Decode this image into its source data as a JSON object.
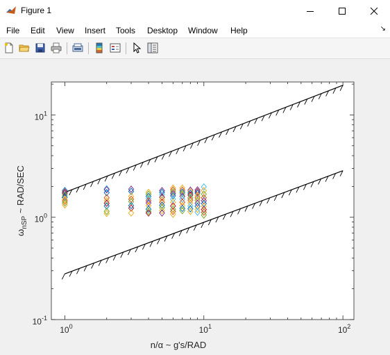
{
  "window": {
    "title": "Figure 1",
    "minimize_icon": "minimize-icon",
    "maximize_icon": "maximize-icon",
    "close_icon": "close-icon"
  },
  "menu": {
    "items": [
      "File",
      "Edit",
      "View",
      "Insert",
      "Tools",
      "Desktop",
      "Window",
      "Help"
    ],
    "dock_icon": "dock-arrow-icon"
  },
  "toolbar": {
    "buttons": [
      "new-figure-icon",
      "open-file-icon",
      "save-icon",
      "print-icon",
      "print-preview-icon",
      "colorbar-icon",
      "legend-icon",
      "pointer-icon",
      "property-inspector-icon"
    ]
  },
  "colors": {
    "series": [
      "#0072BD",
      "#D95319",
      "#EDB120",
      "#7E2F8E",
      "#77AC30",
      "#4DBEEE",
      "#A2142F"
    ],
    "boundary": "#000000",
    "axes_background": "#ffffff",
    "figure_background": "#f0f0f0"
  },
  "chart_data": {
    "type": "scatter",
    "title": "",
    "xlabel": "n/α ~ g's/RAD",
    "ylabel": "ω_nSP ~ RAD/SEC",
    "xscale": "log",
    "yscale": "log",
    "xlim": [
      0.8,
      120
    ],
    "ylim": [
      0.1,
      21
    ],
    "grid": false,
    "legend": "none",
    "x_ticks": [
      {
        "value": 1,
        "base": "10",
        "exp": "0"
      },
      {
        "value": 10,
        "base": "10",
        "exp": "1"
      },
      {
        "value": 100,
        "base": "10",
        "exp": "2"
      }
    ],
    "y_ticks": [
      {
        "value": 0.1,
        "base": "10",
        "exp": "-1"
      },
      {
        "value": 1,
        "base": "10",
        "exp": "0"
      },
      {
        "value": 10,
        "base": "10",
        "exp": "1"
      }
    ],
    "ylabel_parts": {
      "omega": "ω",
      "sub": "nSP",
      "rest": " ~ RAD/SEC"
    },
    "boundaries": [
      {
        "name": "upper",
        "x": [
          1,
          100
        ],
        "y": [
          1.75,
          19.5
        ],
        "hatch": "below"
      },
      {
        "name": "lower",
        "x": [
          1,
          100
        ],
        "y": [
          0.28,
          2.85
        ],
        "hatch": "below"
      }
    ],
    "marker": "diamond",
    "points": [
      {
        "x": 1,
        "y": 1.82,
        "c": 0
      },
      {
        "x": 1,
        "y": 1.76,
        "c": 6
      },
      {
        "x": 1,
        "y": 1.71,
        "c": 3
      },
      {
        "x": 1,
        "y": 1.65,
        "c": 4
      },
      {
        "x": 1,
        "y": 1.57,
        "c": 0
      },
      {
        "x": 1,
        "y": 1.5,
        "c": 2
      },
      {
        "x": 1,
        "y": 1.44,
        "c": 1
      },
      {
        "x": 1,
        "y": 1.38,
        "c": 4
      },
      {
        "x": 1,
        "y": 1.32,
        "c": 2
      },
      {
        "x": 2,
        "y": 1.9,
        "c": 5
      },
      {
        "x": 2,
        "y": 1.86,
        "c": 3
      },
      {
        "x": 2,
        "y": 1.74,
        "c": 0
      },
      {
        "x": 2,
        "y": 1.55,
        "c": 1
      },
      {
        "x": 2,
        "y": 1.45,
        "c": 2
      },
      {
        "x": 2,
        "y": 1.37,
        "c": 6
      },
      {
        "x": 2,
        "y": 1.29,
        "c": 0
      },
      {
        "x": 2,
        "y": 1.14,
        "c": 4
      },
      {
        "x": 2,
        "y": 1.09,
        "c": 2
      },
      {
        "x": 3,
        "y": 1.88,
        "c": 3
      },
      {
        "x": 3,
        "y": 1.79,
        "c": 0
      },
      {
        "x": 3,
        "y": 1.6,
        "c": 2
      },
      {
        "x": 3,
        "y": 1.5,
        "c": 1
      },
      {
        "x": 3,
        "y": 1.42,
        "c": 4
      },
      {
        "x": 3,
        "y": 1.3,
        "c": 0
      },
      {
        "x": 3,
        "y": 1.23,
        "c": 6
      },
      {
        "x": 3,
        "y": 1.1,
        "c": 2
      },
      {
        "x": 4,
        "y": 1.75,
        "c": 2
      },
      {
        "x": 4,
        "y": 1.68,
        "c": 4
      },
      {
        "x": 4,
        "y": 1.6,
        "c": 0
      },
      {
        "x": 4,
        "y": 1.52,
        "c": 5
      },
      {
        "x": 4,
        "y": 1.45,
        "c": 1
      },
      {
        "x": 4,
        "y": 1.38,
        "c": 3
      },
      {
        "x": 4,
        "y": 1.3,
        "c": 2
      },
      {
        "x": 4,
        "y": 1.2,
        "c": 0
      },
      {
        "x": 4,
        "y": 1.14,
        "c": 4
      },
      {
        "x": 4,
        "y": 1.1,
        "c": 6
      },
      {
        "x": 5,
        "y": 1.82,
        "c": 3
      },
      {
        "x": 5,
        "y": 1.75,
        "c": 0
      },
      {
        "x": 5,
        "y": 1.66,
        "c": 5
      },
      {
        "x": 5,
        "y": 1.57,
        "c": 6
      },
      {
        "x": 5,
        "y": 1.48,
        "c": 2
      },
      {
        "x": 5,
        "y": 1.4,
        "c": 1
      },
      {
        "x": 5,
        "y": 1.31,
        "c": 0
      },
      {
        "x": 5,
        "y": 1.24,
        "c": 4
      },
      {
        "x": 5,
        "y": 1.16,
        "c": 2
      },
      {
        "x": 5,
        "y": 1.1,
        "c": 3
      },
      {
        "x": 6,
        "y": 1.93,
        "c": 2
      },
      {
        "x": 6,
        "y": 1.85,
        "c": 1
      },
      {
        "x": 6,
        "y": 1.77,
        "c": 4
      },
      {
        "x": 6,
        "y": 1.7,
        "c": 3
      },
      {
        "x": 6,
        "y": 1.62,
        "c": 0
      },
      {
        "x": 6,
        "y": 1.5,
        "c": 5
      },
      {
        "x": 6,
        "y": 1.4,
        "c": 2
      },
      {
        "x": 6,
        "y": 1.29,
        "c": 6
      },
      {
        "x": 6,
        "y": 1.2,
        "c": 4
      },
      {
        "x": 6,
        "y": 1.14,
        "c": 1
      },
      {
        "x": 6,
        "y": 1.07,
        "c": 2
      },
      {
        "x": 7,
        "y": 1.93,
        "c": 2
      },
      {
        "x": 7,
        "y": 1.84,
        "c": 1
      },
      {
        "x": 7,
        "y": 1.76,
        "c": 0
      },
      {
        "x": 7,
        "y": 1.69,
        "c": 4
      },
      {
        "x": 7,
        "y": 1.6,
        "c": 3
      },
      {
        "x": 7,
        "y": 1.5,
        "c": 5
      },
      {
        "x": 7,
        "y": 1.4,
        "c": 1
      },
      {
        "x": 7,
        "y": 1.3,
        "c": 2
      },
      {
        "x": 7,
        "y": 1.22,
        "c": 0
      },
      {
        "x": 7,
        "y": 1.16,
        "c": 4
      },
      {
        "x": 8,
        "y": 1.84,
        "c": 3
      },
      {
        "x": 8,
        "y": 1.78,
        "c": 2
      },
      {
        "x": 8,
        "y": 1.72,
        "c": 0
      },
      {
        "x": 8,
        "y": 1.65,
        "c": 6
      },
      {
        "x": 8,
        "y": 1.55,
        "c": 4
      },
      {
        "x": 8,
        "y": 1.47,
        "c": 1
      },
      {
        "x": 8,
        "y": 1.38,
        "c": 2
      },
      {
        "x": 8,
        "y": 1.29,
        "c": 5
      },
      {
        "x": 8,
        "y": 1.21,
        "c": 0
      },
      {
        "x": 8,
        "y": 1.14,
        "c": 2
      },
      {
        "x": 9,
        "y": 1.85,
        "c": 3
      },
      {
        "x": 9,
        "y": 1.78,
        "c": 6
      },
      {
        "x": 9,
        "y": 1.72,
        "c": 0
      },
      {
        "x": 9,
        "y": 1.63,
        "c": 2
      },
      {
        "x": 9,
        "y": 1.55,
        "c": 1
      },
      {
        "x": 9,
        "y": 1.46,
        "c": 4
      },
      {
        "x": 9,
        "y": 1.37,
        "c": 3
      },
      {
        "x": 9,
        "y": 1.28,
        "c": 0
      },
      {
        "x": 9,
        "y": 1.19,
        "c": 2
      },
      {
        "x": 9,
        "y": 1.12,
        "c": 5
      },
      {
        "x": 10,
        "y": 1.98,
        "c": 5
      },
      {
        "x": 10,
        "y": 1.82,
        "c": 2
      },
      {
        "x": 10,
        "y": 1.68,
        "c": 4
      },
      {
        "x": 10,
        "y": 1.55,
        "c": 1
      },
      {
        "x": 10,
        "y": 1.45,
        "c": 3
      },
      {
        "x": 10,
        "y": 1.36,
        "c": 0
      },
      {
        "x": 10,
        "y": 1.28,
        "c": 2
      },
      {
        "x": 10,
        "y": 1.19,
        "c": 6
      },
      {
        "x": 10,
        "y": 1.12,
        "c": 1
      },
      {
        "x": 10,
        "y": 1.05,
        "c": 4
      }
    ]
  }
}
